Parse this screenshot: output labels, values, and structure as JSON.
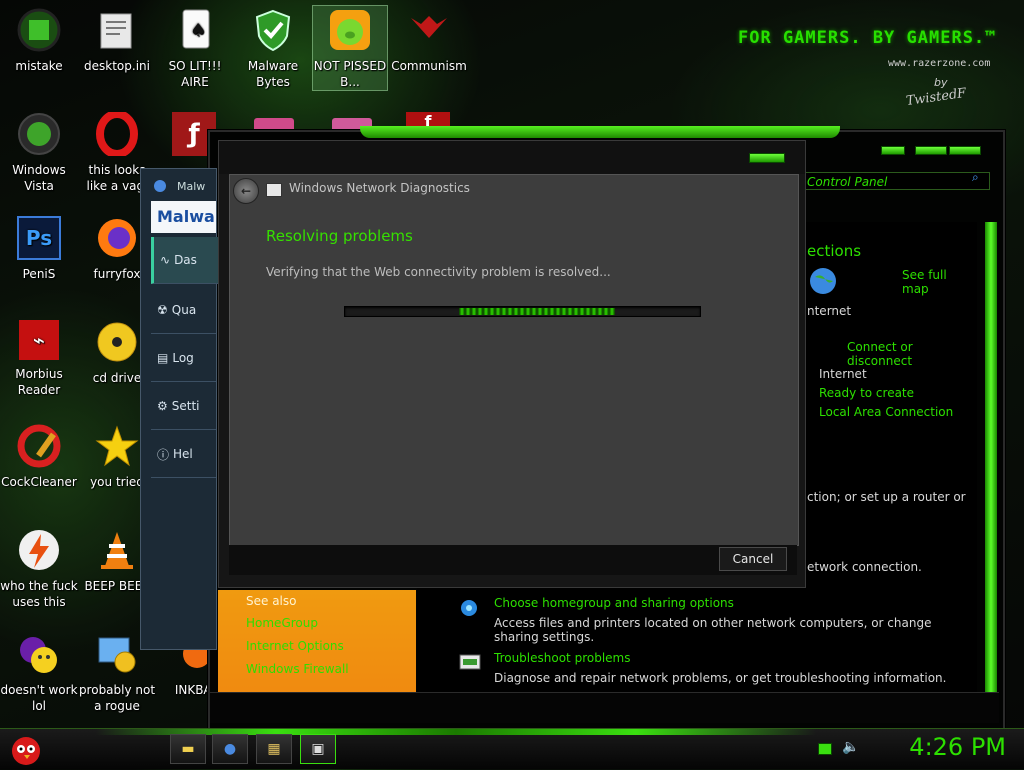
{
  "brand": {
    "tagline": "FOR GAMERS. BY GAMERS.™",
    "url": "www.razerzone.com",
    "byline": "by",
    "signature": "TwistedF"
  },
  "desktop_icons": [
    {
      "label": "mistake",
      "icon": "green-orb-icon"
    },
    {
      "label": "desktop.ini",
      "icon": "ini-file-icon"
    },
    {
      "label": "SO LIT!!! AIRE",
      "icon": "playing-card-icon"
    },
    {
      "label": "Malware Bytes",
      "icon": "shield-check-icon"
    },
    {
      "label": "NOT PISSED B...",
      "icon": "green-pig-icon"
    },
    {
      "label": "Communism",
      "icon": "razer-logo-icon"
    },
    {
      "label": "Windows Vista",
      "icon": "recycle-bin-icon"
    },
    {
      "label": "this looks like a vagi",
      "icon": "opera-icon"
    },
    {
      "label": "PeniS",
      "icon": "photoshop-icon"
    },
    {
      "label": "furryfox",
      "icon": "firefox-icon"
    },
    {
      "label": "Morbius Reader",
      "icon": "pdf-reader-icon"
    },
    {
      "label": "cd drive",
      "icon": "cd-icon"
    },
    {
      "label": "CockCleaner",
      "icon": "ccleaner-icon"
    },
    {
      "label": "you tried",
      "icon": "star-icon"
    },
    {
      "label": "who the fuck uses this",
      "icon": "lightning-icon"
    },
    {
      "label": "BEEP BEEP",
      "icon": "vlc-cone-icon"
    },
    {
      "label": "doesn't work lol",
      "icon": "yahoo-messenger-icon"
    },
    {
      "label": "probably not a rogue",
      "icon": "control-panel-icon"
    },
    {
      "label": "INKBAI",
      "icon": "app-icon"
    }
  ],
  "control_panel": {
    "address": "Control Panel",
    "heading_partial": "ections",
    "see_full_map": "See full map",
    "internet_label": "nternet",
    "connect_disconnect": "Connect or disconnect",
    "network_internet": "Internet",
    "ready_to_create": "Ready to create",
    "local_area_connection": "Local Area Connection",
    "router_text": "ction; or set up a router or",
    "network_connection_text": "etwork connection.",
    "see_also": {
      "title": "See also",
      "links": [
        "HomeGroup",
        "Internet Options",
        "Windows Firewall"
      ]
    },
    "tasks": [
      {
        "title": "Choose homegroup and sharing options",
        "desc": "Access files and printers located on other network computers, or change sharing settings."
      },
      {
        "title": "Troubleshoot problems",
        "desc": "Diagnose and repair network problems, or get troubleshooting information."
      }
    ]
  },
  "malwarebytes": {
    "title": "Malw",
    "logo": "Malwa",
    "items": [
      "Das",
      "Qua",
      "Log",
      "Setti",
      "Hel"
    ]
  },
  "dialog": {
    "title": "Windows Network Diagnostics",
    "heading": "Resolving problems",
    "status": "Verifying that the Web connectivity problem is resolved...",
    "progress": 0.32,
    "cancel_label": "Cancel"
  },
  "taskbar": {
    "clock": "4:26 PM"
  },
  "colors": {
    "accent_green": "#2de000",
    "orange_panel": "#f09a10"
  }
}
